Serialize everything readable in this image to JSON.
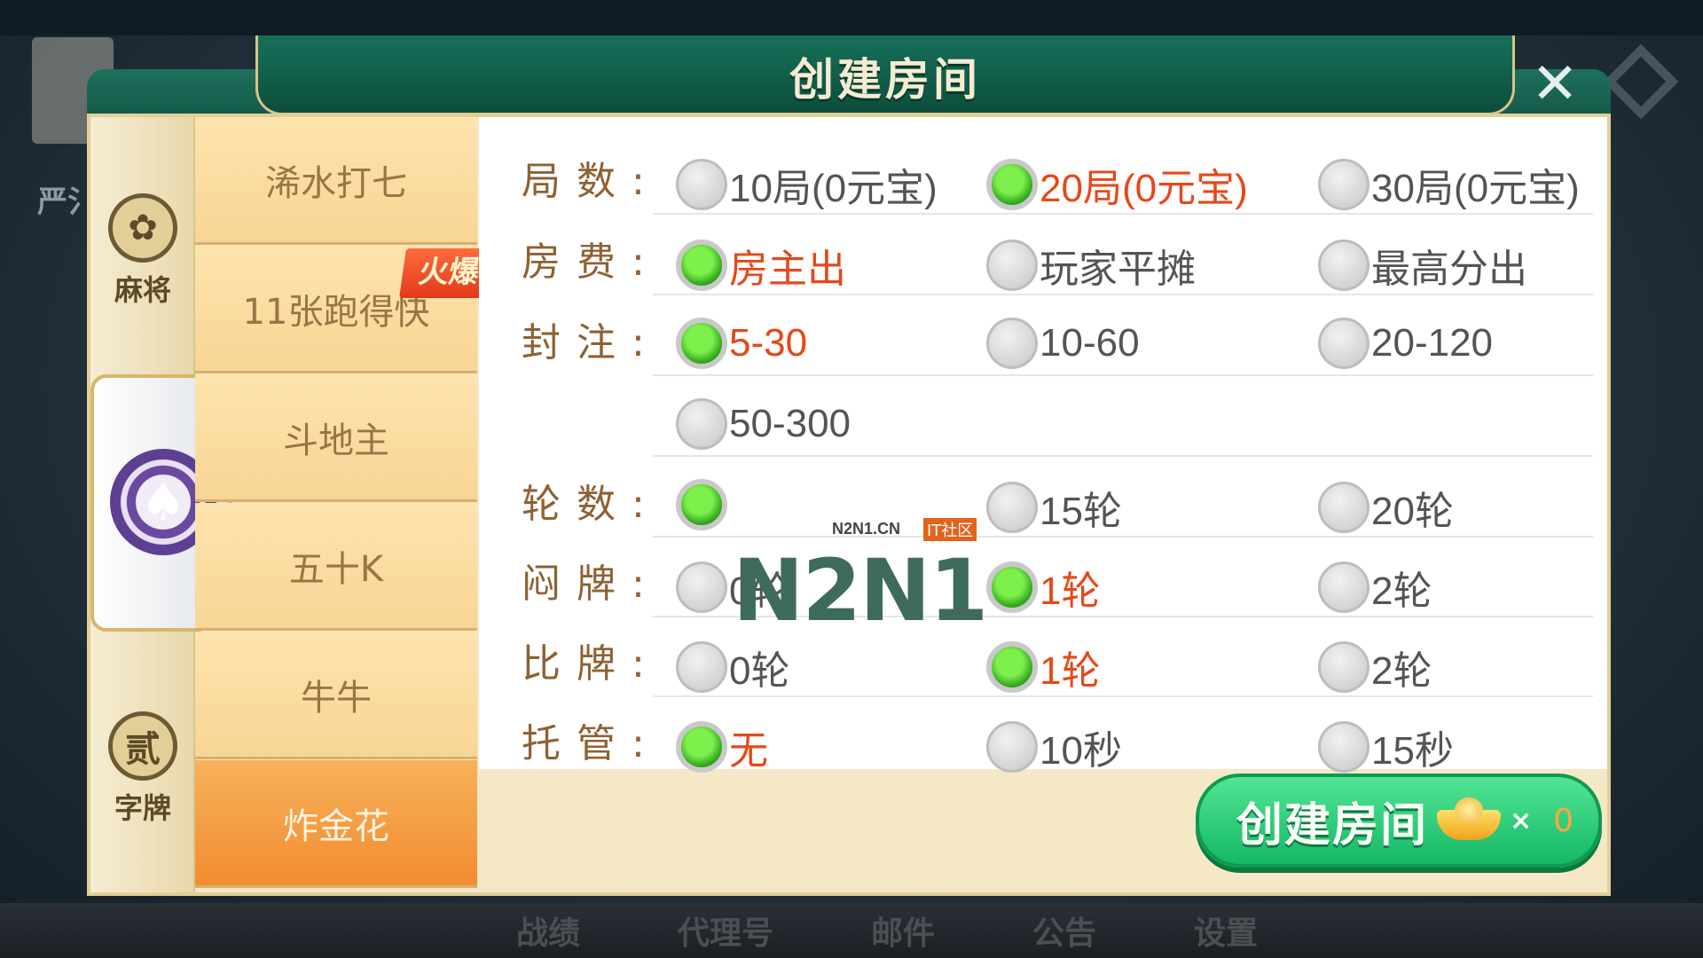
{
  "dialog": {
    "title": "创建房间",
    "close_glyph": "✕"
  },
  "background": {
    "side_text": "严氵",
    "bottom_nav": [
      "战绩",
      "代理号",
      "邮件",
      "公告",
      "设置"
    ]
  },
  "categories": [
    {
      "label": "麻将",
      "icon": "mahjong-flower-icon",
      "glyph": "✿"
    },
    {
      "label": "",
      "icon": "poker-chip-spade-icon",
      "glyph": "♠",
      "active": true
    },
    {
      "label": "字牌",
      "icon": "zipai-character-icon",
      "glyph": "贰"
    }
  ],
  "games": [
    {
      "label": "浠水打七"
    },
    {
      "label": "11张跑得快",
      "badge": "火爆"
    },
    {
      "label": "斗地主"
    },
    {
      "label": "五十K"
    },
    {
      "label": "牛牛"
    },
    {
      "label": "炸金花",
      "active": true
    }
  ],
  "rows": [
    {
      "label": "局数:",
      "options": [
        {
          "text": "10局(0元宝)",
          "selected": false
        },
        {
          "text": "20局(0元宝)",
          "selected": true
        },
        {
          "text": "30局(0元宝)",
          "selected": false
        }
      ]
    },
    {
      "label": "房费:",
      "options": [
        {
          "text": "房主出",
          "selected": true
        },
        {
          "text": "玩家平摊",
          "selected": false
        },
        {
          "text": "最高分出",
          "selected": false
        }
      ]
    },
    {
      "label": "封注:",
      "options": [
        {
          "text": "5-30",
          "selected": true
        },
        {
          "text": "10-60",
          "selected": false
        },
        {
          "text": "20-120",
          "selected": false
        }
      ]
    },
    {
      "label": "",
      "options": [
        {
          "text": "50-300",
          "selected": false
        }
      ]
    },
    {
      "label": "轮数:",
      "options": [
        {
          "text": "",
          "selected": true
        },
        {
          "text": "15轮",
          "selected": false
        },
        {
          "text": "20轮",
          "selected": false
        }
      ]
    },
    {
      "label": "闷牌:",
      "options": [
        {
          "text": "0轮",
          "selected": false
        },
        {
          "text": "1轮",
          "selected": true
        },
        {
          "text": "2轮",
          "selected": false
        }
      ]
    },
    {
      "label": "比牌:",
      "options": [
        {
          "text": "0轮",
          "selected": false
        },
        {
          "text": "1轮",
          "selected": true
        },
        {
          "text": "2轮",
          "selected": false
        }
      ]
    },
    {
      "label": "托管:",
      "options": [
        {
          "text": "无",
          "selected": true
        },
        {
          "text": "10秒",
          "selected": false
        },
        {
          "text": "15秒",
          "selected": false
        }
      ]
    }
  ],
  "watermark": {
    "logo": "N2N1",
    "site": "N2N1.CN",
    "tag": "IT社区"
  },
  "create_button": {
    "label": "创建房间",
    "multiplier": "×",
    "count": "0",
    "icon": "gold-ingot-icon"
  },
  "colors": {
    "selected_text": "#e5481a",
    "label_text": "#8e6133",
    "title_green": "#17705a",
    "button_green": "#14b866",
    "active_tab": "#f38c30"
  }
}
